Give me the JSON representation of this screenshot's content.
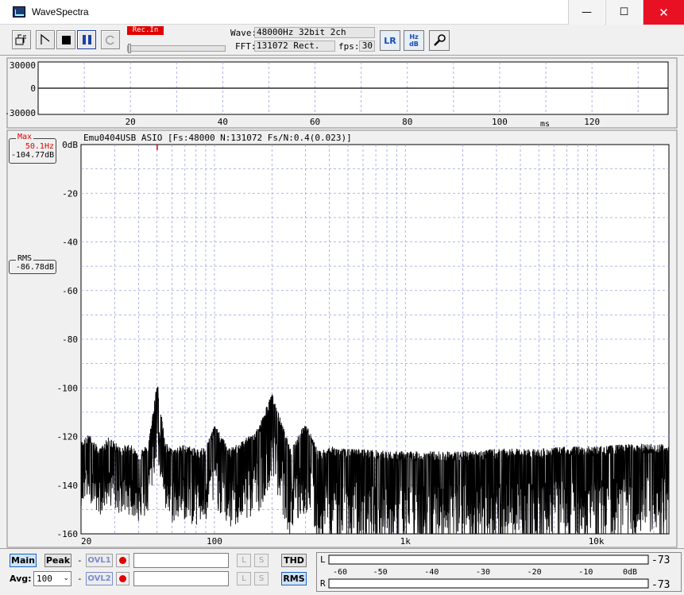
{
  "window": {
    "title": "WaveSpectra",
    "minimize_glyph": "—",
    "maximize_glyph": "☐",
    "close_glyph": "✕"
  },
  "toolbar": {
    "rec_in_label": "Rec.In",
    "wave_label": "Wave:",
    "wave_value": "48000Hz 32bit 2ch",
    "fft_label": "FFT:",
    "fft_value": "131072 Rect.",
    "fps_label": "fps:",
    "fps_value": "30",
    "lr_label": "LR",
    "hz_db_label": "Hz dB",
    "buttons": [
      "open-icon",
      "record-icon",
      "stop-icon",
      "pause-icon",
      "loop-icon",
      "lr-icon",
      "hz-db-icon",
      "settings-wrench-icon"
    ]
  },
  "waveform": {
    "y_ticks": [
      "30000",
      "0",
      "-30000"
    ],
    "x_ticks": [
      "20",
      "40",
      "60",
      "80",
      "100",
      "120"
    ],
    "x_unit": "ms"
  },
  "spectrum": {
    "header": "Emu0404USB ASIO  [Fs:48000 N:131072 Fs/N:0.4(0.023)]",
    "max_caption": "Max",
    "max_freq": "50.1Hz",
    "max_level": "-104.77dB",
    "rms_caption": "RMS",
    "rms_level": "-86.78dB",
    "y_ticks": [
      "0dB",
      "-20",
      "-40",
      "-60",
      "-80",
      "-100",
      "-120",
      "-140",
      "-160"
    ],
    "x_ticks": [
      "20",
      "100",
      "1k",
      "10k"
    ]
  },
  "bottom": {
    "main_label": "Main",
    "peak_label": "Peak",
    "dash": "-",
    "ovl1_label": "OVL1",
    "ovl2_label": "OVL2",
    "avg_label": "Avg:",
    "avg_value": "100",
    "l_label": "L",
    "s_label": "S",
    "thd_label": "THD",
    "rms_label": "RMS",
    "meter_l": "L",
    "meter_r": "R",
    "meter_scale": [
      "-60",
      "-50",
      "-40",
      "-30",
      "-20",
      "-10",
      "0dB"
    ],
    "meter_l_value": "-73",
    "meter_r_value": "-73"
  },
  "chart_data": {
    "type": "line",
    "title": "",
    "xlabel": "",
    "ylabel": "",
    "x_scale": "log",
    "xlim": [
      20,
      24000
    ],
    "ylim": [
      -160,
      0
    ],
    "grid": true,
    "series": [
      {
        "x": [
          20,
          22,
          25,
          28,
          32,
          36,
          40,
          45,
          50.1,
          55,
          60,
          70,
          80,
          90,
          100,
          120,
          150,
          170,
          200,
          250,
          300,
          350,
          400,
          500,
          600,
          800,
          1000,
          1500,
          2000,
          3000,
          5000,
          7000,
          10000,
          15000,
          20000,
          24000
        ],
        "values": [
          -130,
          -127,
          -133,
          -128,
          -132,
          -131,
          -134,
          -131,
          -105,
          -130,
          -133,
          -131,
          -133,
          -132,
          -123,
          -133,
          -128,
          -124,
          -110,
          -133,
          -122,
          -134,
          -132,
          -133,
          -133,
          -134,
          -134,
          -134,
          -134,
          -133,
          -133,
          -132,
          -132,
          -131,
          -131,
          -131
        ]
      }
    ],
    "peak_marker": {
      "x": 50.1,
      "value": -104.77
    }
  }
}
